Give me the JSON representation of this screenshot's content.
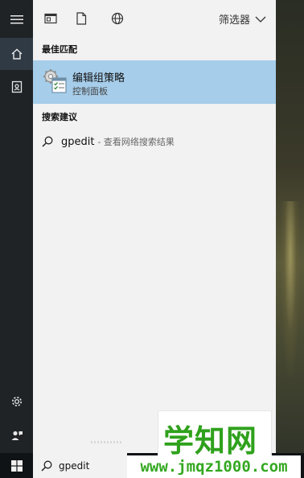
{
  "toolbar": {
    "filter_label": "筛选器",
    "icons": [
      "apps-icon",
      "document-icon",
      "web-icon",
      "chevron-down-icon"
    ]
  },
  "sections": {
    "best_match_title": "最佳匹配",
    "suggest_title": "搜索建议"
  },
  "best_match": {
    "title": "编辑组策略",
    "subtitle": "控制面板",
    "icon": "group-policy-icon"
  },
  "suggestion": {
    "query": "gpedit",
    "description": "- 查看网络搜索结果",
    "icon": "search-icon"
  },
  "rail": {
    "items": [
      "hamburger-menu-icon",
      "home-icon",
      "notebook-icon",
      "settings-icon",
      "feedback-icon"
    ]
  },
  "taskbar": {
    "search_value": "gpedit",
    "start_icon": "windows-logo-icon"
  },
  "watermark": {
    "logo_text": "学知网",
    "url_text": "www.jmqz1000.com"
  },
  "colors": {
    "selected_bg": "#a6cdea",
    "panel_bg": "#f2f2f2",
    "rail_bg": "#1f2326",
    "watermark_green": "#2fa11c"
  }
}
